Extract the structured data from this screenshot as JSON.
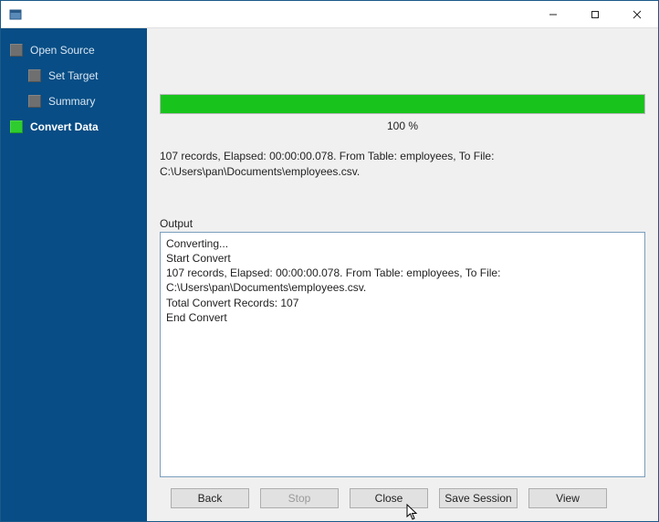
{
  "titlebar": {
    "title": ""
  },
  "sidebar": {
    "items": [
      {
        "label": "Open Source",
        "level": "root",
        "current": false
      },
      {
        "label": "Set Target",
        "level": "child",
        "current": false
      },
      {
        "label": "Summary",
        "level": "child",
        "current": false
      },
      {
        "label": "Convert Data",
        "level": "root",
        "current": true
      }
    ]
  },
  "progress": {
    "percent_text": "100 %",
    "fill_percent": 100
  },
  "summary": {
    "line": "107 records,   Elapsed: 00:00:00.078.   From Table: employees,   To File: C:\\Users\\pan\\Documents\\employees.csv."
  },
  "output": {
    "label": "Output",
    "lines": [
      "Converting...",
      "Start Convert",
      "107 records,   Elapsed: 00:00:00.078.   From Table: employees,   To File: C:\\Users\\pan\\Documents\\employees.csv.",
      "Total Convert Records: 107",
      "End Convert"
    ]
  },
  "buttons": {
    "back": "Back",
    "stop": "Stop",
    "close": "Close",
    "save_session": "Save Session",
    "view": "View"
  },
  "colors": {
    "sidebar_bg": "#084d85",
    "progress_fill": "#18c41c",
    "active_step": "#2ecc2e"
  }
}
